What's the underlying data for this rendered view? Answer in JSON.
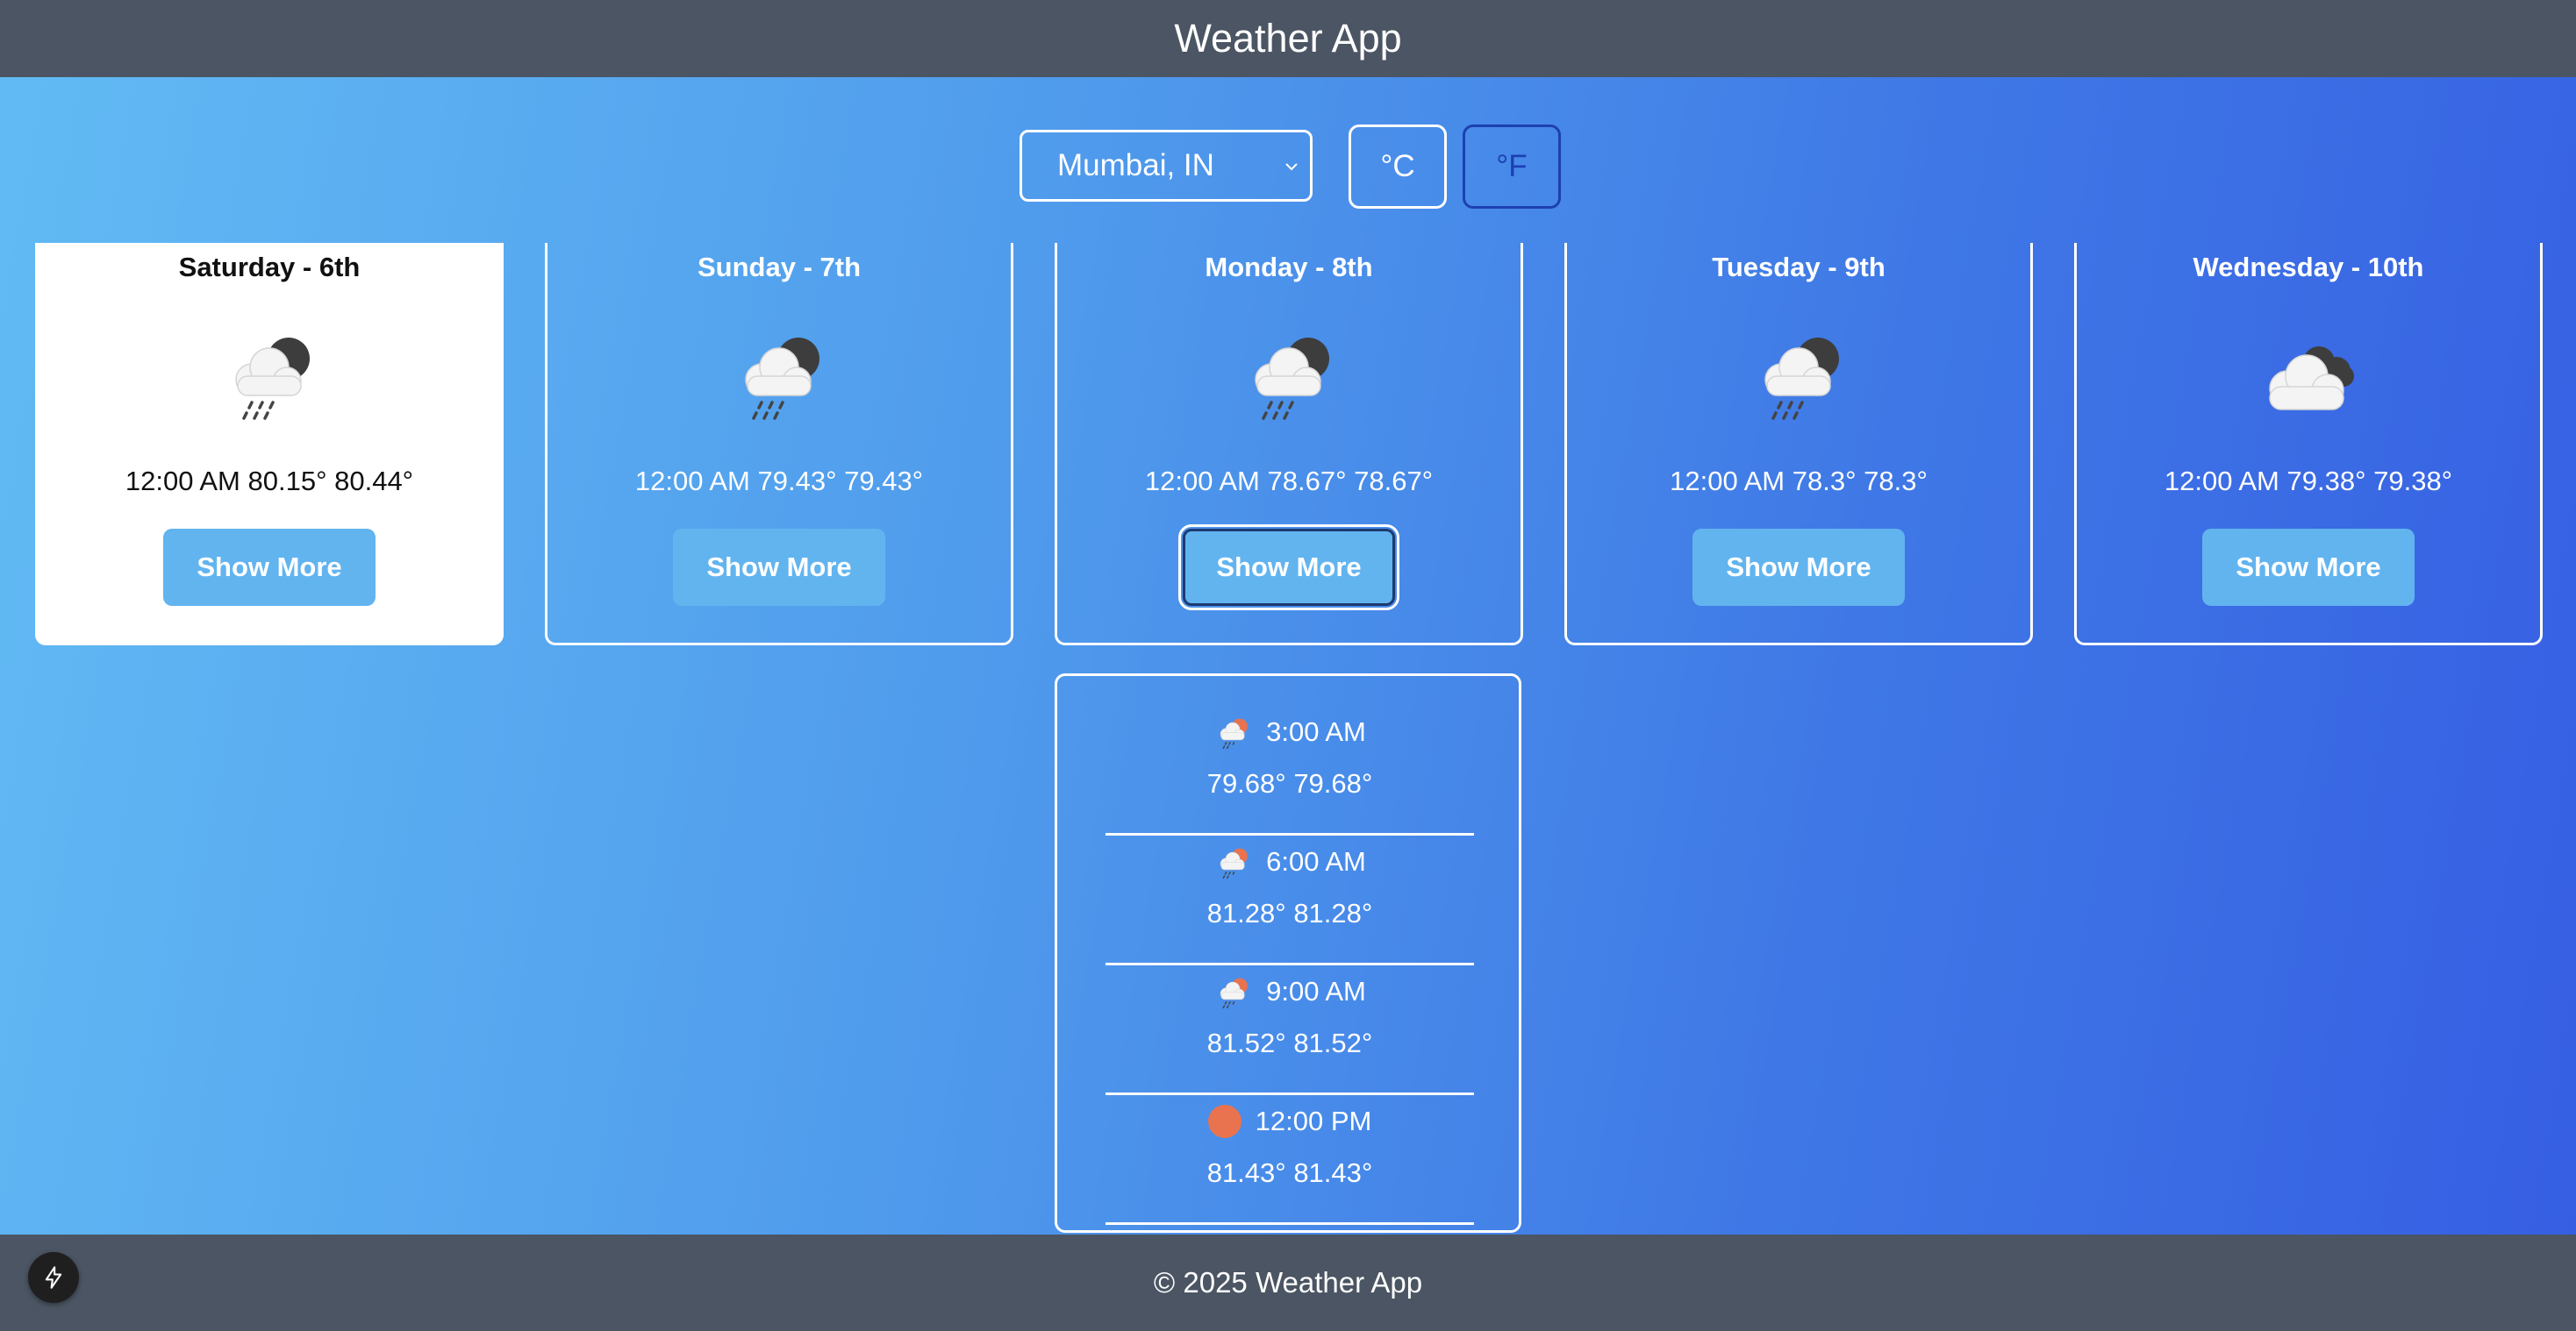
{
  "header": {
    "title": "Weather App"
  },
  "controls": {
    "city": "Mumbai, IN",
    "units": [
      {
        "label": "°C",
        "active": false
      },
      {
        "label": "°F",
        "active": true
      }
    ]
  },
  "days": [
    {
      "day": "Saturday - 6th",
      "time": "12:00 AM",
      "temp": "80.15°",
      "feels": "80.44°",
      "icon": "rain-night-icon",
      "button": "Show More"
    },
    {
      "day": "Sunday - 7th",
      "time": "12:00 AM",
      "temp": "79.43°",
      "feels": "79.43°",
      "icon": "rain-night-icon",
      "button": "Show More"
    },
    {
      "day": "Monday - 8th",
      "time": "12:00 AM",
      "temp": "78.67°",
      "feels": "78.67°",
      "icon": "rain-night-icon",
      "button": "Show More"
    },
    {
      "day": "Tuesday - 9th",
      "time": "12:00 AM",
      "temp": "78.3°",
      "feels": "78.3°",
      "icon": "rain-night-icon",
      "button": "Show More"
    },
    {
      "day": "Wednesday - 10th",
      "time": "12:00 AM",
      "temp": "79.38°",
      "feels": "79.38°",
      "icon": "cloudy-icon",
      "button": "Show More"
    }
  ],
  "detail": {
    "hours": [
      {
        "time": "3:00 AM",
        "temp": "79.68°",
        "feels": "79.68°",
        "icon": "rain-day-icon"
      },
      {
        "time": "6:00 AM",
        "temp": "81.28°",
        "feels": "81.28°",
        "icon": "rain-day-icon"
      },
      {
        "time": "9:00 AM",
        "temp": "81.52°",
        "feels": "81.52°",
        "icon": "rain-day-icon"
      },
      {
        "time": "12:00 PM",
        "temp": "81.43°",
        "feels": "81.43°",
        "icon": "sun-icon"
      }
    ]
  },
  "footer": {
    "text": "© 2025 Weather App"
  },
  "colors": {
    "header_bg": "#4b5563",
    "button_bg": "#62b4ef",
    "sun": "#e8734e",
    "active_unit": "#1d3fb3"
  }
}
